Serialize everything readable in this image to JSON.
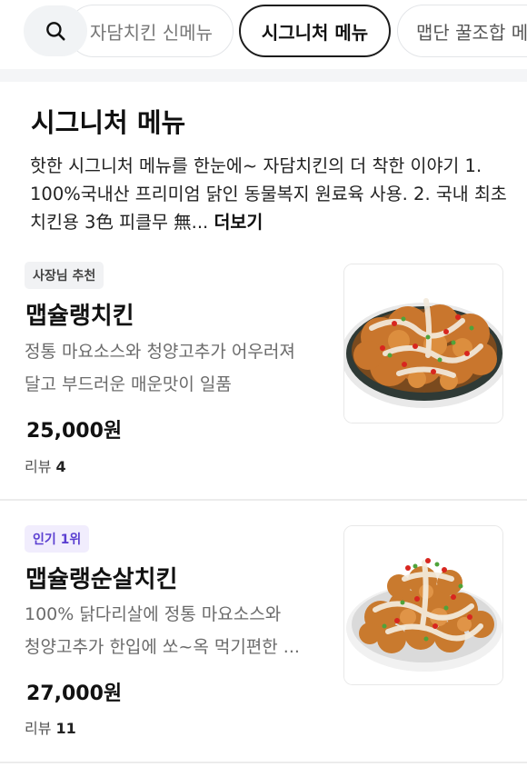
{
  "tabs": {
    "items": [
      {
        "label": "자담치킨 신메뉴"
      },
      {
        "label": "시그니처 메뉴"
      },
      {
        "label": "맵단 꿀조합 메"
      }
    ]
  },
  "section": {
    "title": "시그니처 메뉴",
    "description": "핫한 시그니처 메뉴를 한눈에~ 자담치킨의 더 착한 이야기 1. 100%국내산 프리미엄 닭인 동물복지 원료육 사용. 2. 국내 최초 치킨용 3色 피클무 無...",
    "more_label": "더보기"
  },
  "menu": [
    {
      "badge": "사장님 추천",
      "name": "맵슐랭치킨",
      "desc_line1": "정통 마요소스와 청양고추가 어우러져",
      "desc_line2": "달고 부드러운 매운맛이 일품",
      "price": "25,000원",
      "review_label": "리뷰",
      "review_count": "4"
    },
    {
      "badge": "인기 1위",
      "name": "맵슐랭순살치킨",
      "desc_line1": "100% 닭다리살에 정통 마요소스와",
      "desc_line2": "청양고추가 한입에 쏘~옥 먹기편한 ...",
      "price": "27,000원",
      "review_label": "리뷰",
      "review_count": "11"
    }
  ],
  "colors": {
    "badge_purple_text": "#5b3fd1",
    "badge_purple_bg": "#f1edfd",
    "active_tab_border": "#1c1c1c"
  }
}
